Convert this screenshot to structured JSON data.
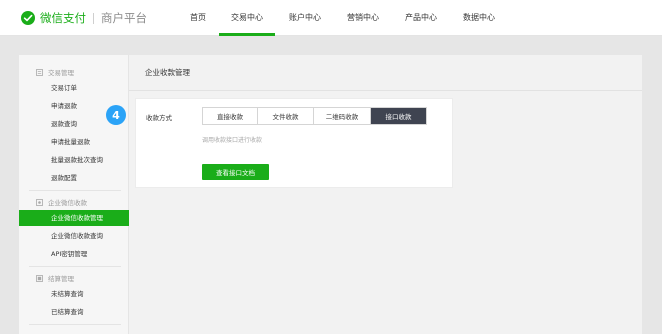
{
  "header": {
    "brand": "微信支付",
    "subtitle": "商户平台",
    "brand_color": "#1aad19",
    "nav": [
      {
        "label": "首页",
        "active": false
      },
      {
        "label": "交易中心",
        "active": true
      },
      {
        "label": "账户中心",
        "active": false
      },
      {
        "label": "营销中心",
        "active": false
      },
      {
        "label": "产品中心",
        "active": false
      },
      {
        "label": "数据中心",
        "active": false
      }
    ]
  },
  "sidebar": {
    "groups": [
      {
        "title": "交易管理",
        "icon": "transaction-icon",
        "items": [
          "交易订单",
          "申请退款",
          "退款查询",
          "申请批量退款",
          "批量退款批次查询",
          "退款配置"
        ]
      },
      {
        "title": "企业微信收款",
        "icon": "wecom-icon",
        "items": [
          "企业微信收款管理",
          "企业微信收款查询",
          "API密钥管理"
        ]
      },
      {
        "title": "结算管理",
        "icon": "settlement-icon",
        "items": [
          "未结算查询",
          "已结算查询"
        ]
      }
    ],
    "active_item": "企业微信收款管理"
  },
  "badge": {
    "value": "4",
    "color": "#2ba3f7"
  },
  "main": {
    "title": "企业收款管理",
    "field_label": "收款方式",
    "options": [
      "直接收款",
      "文件收款",
      "二维码收款",
      "接口收款"
    ],
    "selected_option": "接口收款",
    "hint": "调用收款接口进行收款",
    "doc_button": "查看接口文档"
  }
}
